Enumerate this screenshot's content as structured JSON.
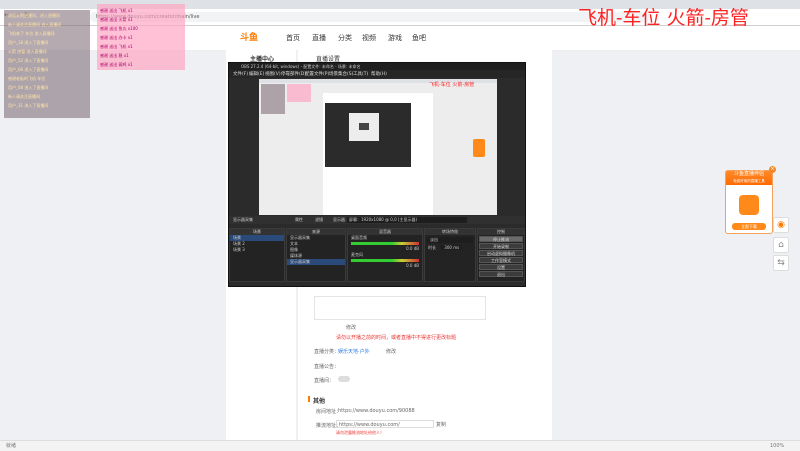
{
  "browser": {
    "url": "https://www.douyu.com/creator/main/live",
    "status_left": "就绪",
    "zoom": "100%"
  },
  "overlay": {
    "title": "飞机-车位  火箭-房管"
  },
  "site": {
    "logo": "斗鱼",
    "nav": [
      "首页",
      "直播",
      "分类",
      "视频",
      "游戏",
      "鱼吧"
    ],
    "section_title": "直播设置",
    "sidebar_title": "主播中心"
  },
  "content": {
    "note_red": "请勿以开播之前的时间，或者直播中不得进行更改标题",
    "edit_label": "修改",
    "category_label": "直播分类：",
    "category_value": "娱乐天地·户外",
    "category_link": "修改",
    "notice_label": "直播公告：",
    "room_label": "直播间：",
    "link_heading": "其他",
    "room_link_label": "房间地址：",
    "room_link_value": "https://www.douyu.com/90088",
    "push_label": "推流地址：",
    "push_value": "https://www.douyu.com/",
    "copy": "复制",
    "warn": "请勿泄露推流地址给他人！"
  },
  "obs": {
    "title": "OBS 27.2.4 (64-bit, windows) - 配置文件: 未命名 - 场景: 未命名",
    "menu": [
      "文件(F)",
      "编辑(E)",
      "视图(V)",
      "停靠部件(D)",
      "配置文件(P)",
      "场景集合(S)",
      "工具(T)",
      "帮助(H)"
    ],
    "source_label": "显示器采集",
    "prop_label": "属性",
    "filter_label": "滤镜",
    "display_label": "显示器",
    "display_value": "屏幕：1920x1080 @ 0,0 (主显示器)",
    "docks": {
      "scenes": "场景",
      "sources": "来源",
      "mixer": "混音器",
      "transitions": "转场特效",
      "controls": "控制"
    },
    "scene_items": [
      "场景",
      "场景 2",
      "场景 3"
    ],
    "source_items": [
      "显示器采集",
      "文本",
      "图像",
      "媒体源",
      "显示器采集"
    ],
    "mixer_items": [
      {
        "name": "桌面音频",
        "db": "0.0 dB"
      },
      {
        "name": "麦克风",
        "db": "0.0 dB"
      }
    ],
    "transition_value": "淡出",
    "duration_label": "时长",
    "duration_value": "300 ms",
    "controls": [
      "停止推流",
      "开始录制",
      "启动虚拟摄像机",
      "工作室模式",
      "设置",
      "退出"
    ]
  },
  "chat_left": [
    "欢迎来到直播间，进入直播间",
    "新人请关注直播间 进入直播间",
    "飞机来了 车位 进入直播间",
    "用户_18 进入了直播间",
    "火箭 房管 进入直播间",
    "用户_52 进入了直播间",
    "用户_66 进入了直播间",
    "感谢老板的飞机 车位",
    "用户_08 进入了直播间",
    "新人请关注直播间",
    "用户_31 进入了直播间"
  ],
  "chat_pink": [
    "感谢 送出 飞机 x1",
    "感谢 送出 火箭 x1",
    "感谢 送出 鱼丸 x100",
    "感谢 送出 办卡 x1",
    "感谢 送出 飞机 x1",
    "感谢 送出 稳 x1",
    "感谢 送出 弱鸡 x1"
  ],
  "ad": {
    "title": "斗鱼直播伴侣",
    "sub": "免费好用的直播工具",
    "button": "立即下载"
  }
}
